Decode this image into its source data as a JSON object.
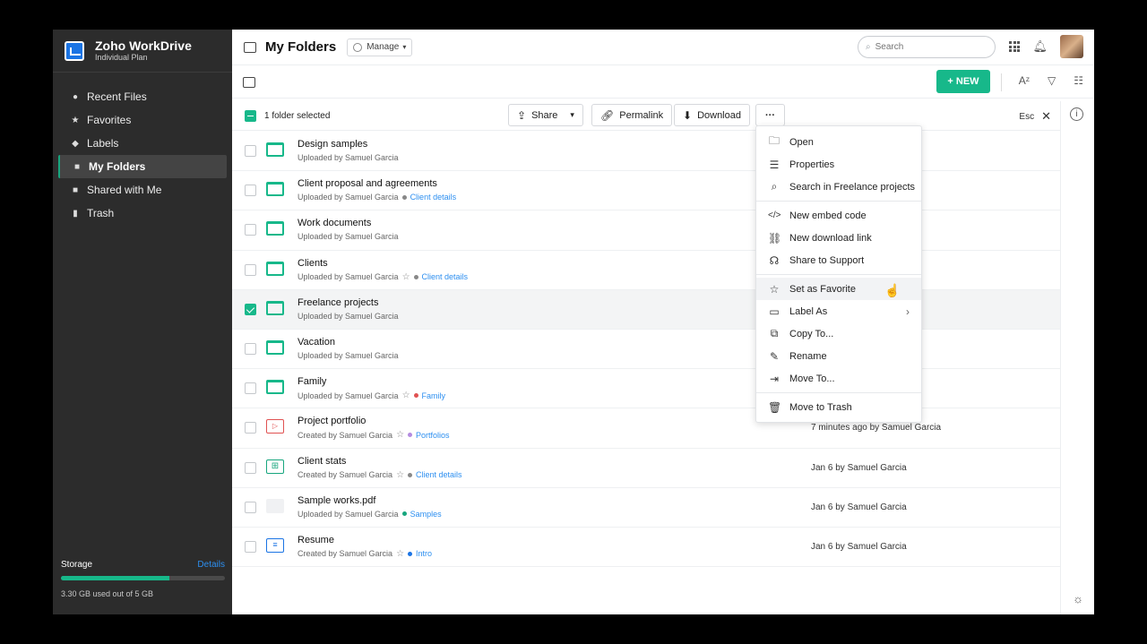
{
  "app": {
    "name": "Zoho WorkDrive",
    "plan": "Individual Plan"
  },
  "sidebar": {
    "items": [
      {
        "label": "Recent Files",
        "icon": "clock-icon"
      },
      {
        "label": "Favorites",
        "icon": "star-icon"
      },
      {
        "label": "Labels",
        "icon": "label-icon"
      },
      {
        "label": "My Folders",
        "icon": "folder-icon",
        "active": true
      },
      {
        "label": "Shared with Me",
        "icon": "shared-icon"
      },
      {
        "label": "Trash",
        "icon": "trash-icon"
      }
    ],
    "storage": {
      "title": "Storage",
      "link": "Details",
      "used_text": "3.30 GB used out of 5 GB",
      "used_fraction": 0.66
    }
  },
  "header": {
    "title": "My Folders",
    "manage_label": "Manage",
    "search_placeholder": "Search"
  },
  "toolbar": {
    "new_label": "+ NEW"
  },
  "selection": {
    "text": "1 folder selected",
    "share": "Share",
    "permalink": "Permalink",
    "download": "Download",
    "esc": "Esc"
  },
  "files": [
    {
      "name": "Design samples",
      "meta": "Uploaded by Samuel Garcia",
      "type": "folder"
    },
    {
      "name": "Client proposal and agreements",
      "meta": "Uploaded by Samuel Garcia",
      "label": "Client details",
      "label_color": "#888888",
      "type": "folder"
    },
    {
      "name": "Work documents",
      "meta": "Uploaded by Samuel Garcia",
      "type": "folder"
    },
    {
      "name": "Clients",
      "meta": "Uploaded by Samuel Garcia",
      "star": true,
      "label": "Client details",
      "label_color": "#888888",
      "type": "folder"
    },
    {
      "name": "Freelance projects",
      "meta": "Uploaded by Samuel Garcia",
      "type": "folder",
      "selected": true
    },
    {
      "name": "Vacation",
      "meta": "Uploaded by Samuel Garcia",
      "type": "folder"
    },
    {
      "name": "Family",
      "meta": "Uploaded by Samuel Garcia",
      "star": true,
      "label": "Family",
      "label_color": "#e05252",
      "type": "folder"
    },
    {
      "name": "Project portfolio",
      "meta": "Created by Samuel Garcia",
      "star": true,
      "label": "Portfolios",
      "label_color": "#b48be0",
      "type": "presentation",
      "date": "7 minutes ago by Samuel Garcia"
    },
    {
      "name": "Client stats",
      "meta": "Created by Samuel Garcia",
      "star": true,
      "label": "Client details",
      "label_color": "#888888",
      "type": "spreadsheet",
      "date": "Jan 6 by Samuel Garcia"
    },
    {
      "name": "Sample works.pdf",
      "meta": "Uploaded by Samuel Garcia",
      "label": "Samples",
      "label_color": "#17a67e",
      "type": "pdf",
      "date": "Jan 6 by Samuel Garcia"
    },
    {
      "name": "Resume",
      "meta": "Created by Samuel Garcia",
      "star": true,
      "label": "Intro",
      "label_color": "#1b74e4",
      "type": "document",
      "date": "Jan 6 by Samuel Garcia"
    }
  ],
  "menu": {
    "groups": [
      [
        {
          "label": "Open",
          "icon": "folder-open-icon"
        },
        {
          "label": "Properties",
          "icon": "properties-icon"
        },
        {
          "label": "Search in Freelance projects",
          "icon": "search-icon"
        }
      ],
      [
        {
          "label": "New embed code",
          "icon": "code-icon"
        },
        {
          "label": "New download link",
          "icon": "link-icon"
        },
        {
          "label": "Share to Support",
          "icon": "support-icon"
        }
      ],
      [
        {
          "label": "Set as Favorite",
          "icon": "star-icon"
        },
        {
          "label": "Label As",
          "icon": "label-icon"
        },
        {
          "label": "Copy To...",
          "icon": "copy-icon"
        },
        {
          "label": "Rename",
          "icon": "pencil-icon"
        },
        {
          "label": "Move To...",
          "icon": "move-icon"
        }
      ],
      [
        {
          "label": "Move to Trash",
          "icon": "trash-icon"
        }
      ]
    ]
  }
}
